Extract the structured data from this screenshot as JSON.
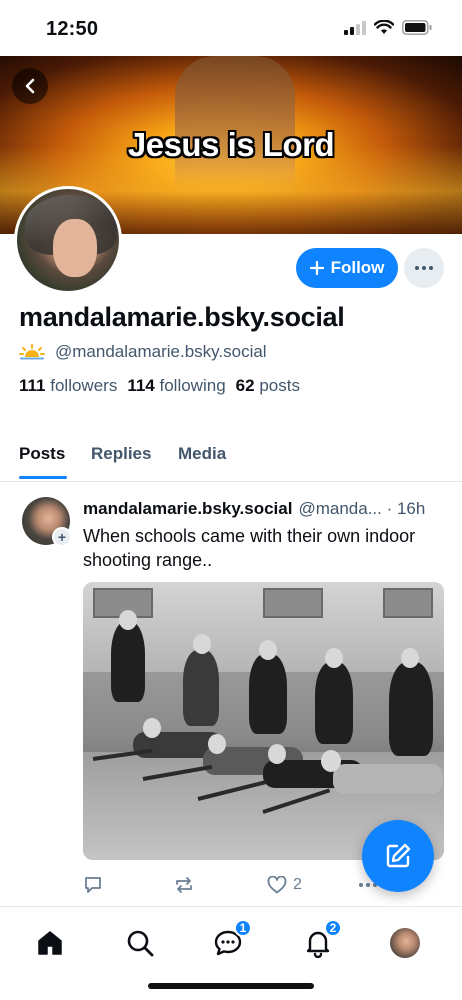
{
  "status_bar": {
    "time": "12:50"
  },
  "banner": {
    "text": "Jesus is Lord"
  },
  "profile": {
    "display_name": "mandalamarie.bsky.social",
    "handle": "@mandalamarie.bsky.social",
    "follow_label": "Follow",
    "stats": {
      "followers_count": "111",
      "followers_label": "followers",
      "following_count": "114",
      "following_label": "following",
      "posts_count": "62",
      "posts_label": "posts"
    }
  },
  "tabs": [
    {
      "label": "Posts",
      "active": true
    },
    {
      "label": "Replies",
      "active": false
    },
    {
      "label": "Media",
      "active": false
    }
  ],
  "post": {
    "author": "mandalamarie.bsky.social",
    "meta": "@manda... · 16h",
    "text": "When schools came with their own indoor shooting range..",
    "like_count": "2"
  },
  "nav": {
    "chat_badge": "1",
    "notifications_badge": "2"
  },
  "colors": {
    "accent": "#1083fe",
    "muted": "#42576c"
  }
}
